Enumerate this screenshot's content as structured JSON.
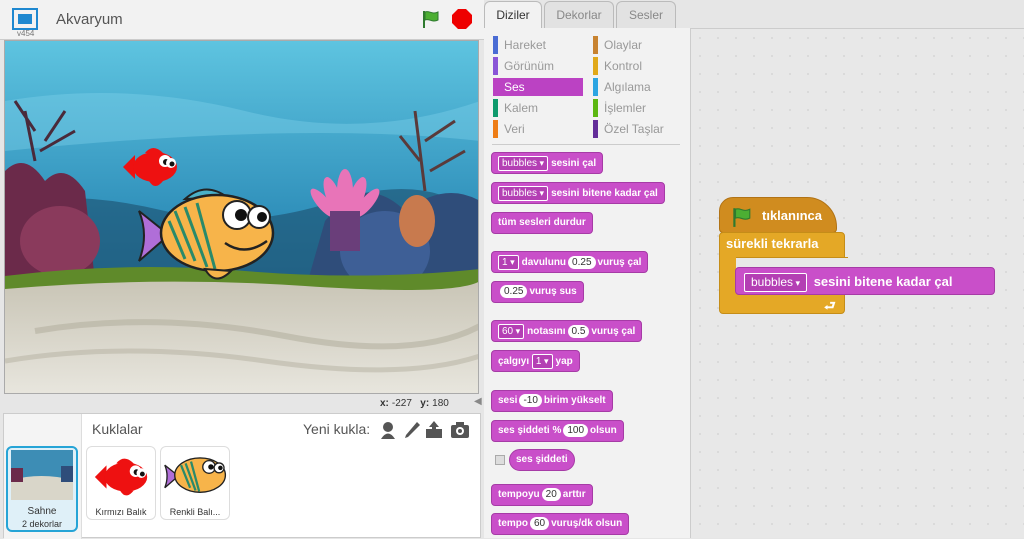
{
  "header": {
    "version": "v454",
    "project_title": "Akvaryum"
  },
  "stage": {
    "coords": {
      "x_label": "x:",
      "x_value": "-227",
      "y_label": "y:",
      "y_value": "180"
    }
  },
  "sprites_panel": {
    "title": "Kuklalar",
    "new_sprite_label": "Yeni kukla:",
    "stage_item": {
      "name": "Sahne",
      "subtitle": "2 dekorlar"
    },
    "sprites": [
      {
        "name": "Kırmızı Balık"
      },
      {
        "name": "Renkli Balı..."
      }
    ]
  },
  "tabs": [
    "Diziler",
    "Dekorlar",
    "Sesler"
  ],
  "categories": {
    "left": [
      {
        "label": "Hareket",
        "color": "#4a6cd4"
      },
      {
        "label": "Görünüm",
        "color": "#8a55d7"
      },
      {
        "label": "Ses",
        "color": "#bb42c3"
      },
      {
        "label": "Kalem",
        "color": "#0e9a6c"
      },
      {
        "label": "Veri",
        "color": "#ee7d16"
      }
    ],
    "right": [
      {
        "label": "Olaylar",
        "color": "#c88330"
      },
      {
        "label": "Kontrol",
        "color": "#e1a91a"
      },
      {
        "label": "Algılama",
        "color": "#2ca5e2"
      },
      {
        "label": "İşlemler",
        "color": "#5cb712"
      },
      {
        "label": "Özel Taşlar",
        "color": "#632d99"
      }
    ]
  },
  "blocks": {
    "play_sound": {
      "dd": "bubbles",
      "text": "sesini çal"
    },
    "play_until": {
      "dd": "bubbles",
      "text": "sesini bitene kadar çal"
    },
    "stop_all": {
      "text": "tüm sesleri durdur"
    },
    "drum": {
      "dd": "1",
      "a": "davulunu",
      "val": "0.25",
      "b": "vuruş çal"
    },
    "rest": {
      "val": "0.25",
      "text": "vuruş sus"
    },
    "note": {
      "dd": "60",
      "a": "notasını",
      "val": "0.5",
      "b": "vuruş çal"
    },
    "instrument": {
      "a": "çalgıyı",
      "dd": "1",
      "b": "yap"
    },
    "change_volume": {
      "a": "sesi",
      "val": "-10",
      "b": "birim yükselt"
    },
    "set_volume": {
      "a": "ses şiddeti %",
      "val": "100",
      "b": "olsun"
    },
    "volume": {
      "text": "ses şiddeti"
    },
    "change_tempo": {
      "a": "tempoyu",
      "val": "20",
      "b": "arttır"
    },
    "set_tempo": {
      "a": "tempo",
      "val": "60",
      "b": "vuruş/dk olsun"
    }
  },
  "script": {
    "hat": "tıklanınca",
    "forever": "sürekli tekrarla",
    "inner": {
      "dd": "bubbles",
      "text": "sesini bitene kadar çal"
    }
  },
  "colors": {
    "sound": "#c94fc9",
    "events": "#d08c1f",
    "control": "#e4a826",
    "accent": "#26a4d6"
  }
}
